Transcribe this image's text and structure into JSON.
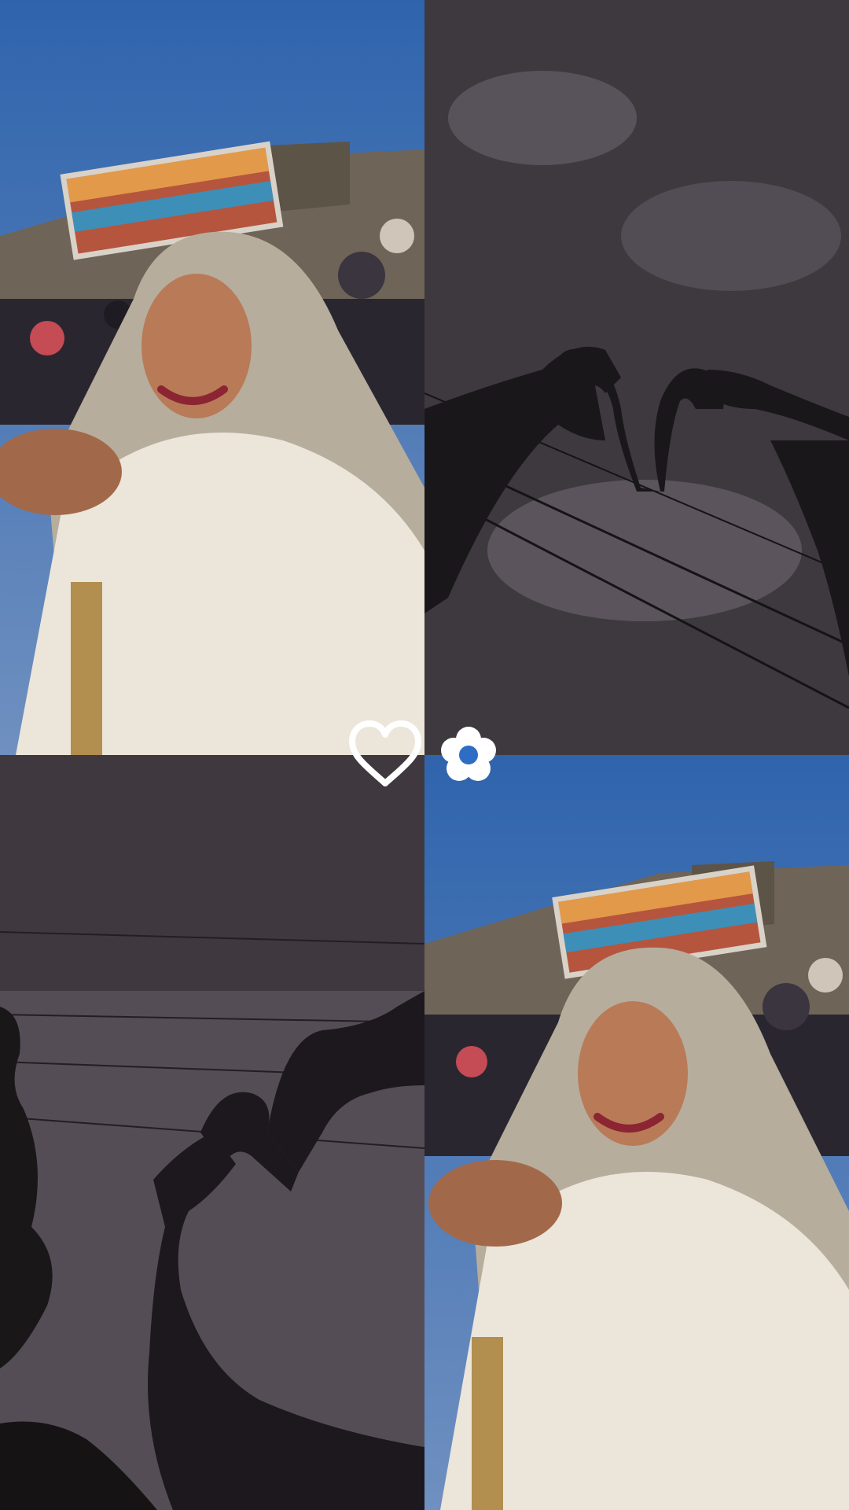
{
  "layout": "2x2-photo-collage",
  "tiles": [
    {
      "position": "top-left",
      "subject": "smiling-woman-photo",
      "palette": {
        "sky": "#3f74b5",
        "scarf": "#b6ad9d",
        "dress": "#ece5d9"
      }
    },
    {
      "position": "top-right",
      "subject": "heart-hands-silhouette",
      "palette": {
        "sky": "#4a464b",
        "silhouette": "#1a171b"
      }
    },
    {
      "position": "bottom-left",
      "subject": "heart-hands-silhouette",
      "palette": {
        "sky": "#5f5660",
        "silhouette": "#1c181d"
      }
    },
    {
      "position": "bottom-right",
      "subject": "smiling-woman-photo",
      "palette": {
        "sky": "#3f74b5",
        "scarf": "#b6ad9d",
        "dress": "#ece5d9"
      }
    }
  ],
  "decorations": [
    {
      "icon": "heart-outline-icon",
      "color": "#ffffff"
    },
    {
      "icon": "flower-icon",
      "color": "#ffffff",
      "center_color": "#2f6dc4"
    }
  ]
}
